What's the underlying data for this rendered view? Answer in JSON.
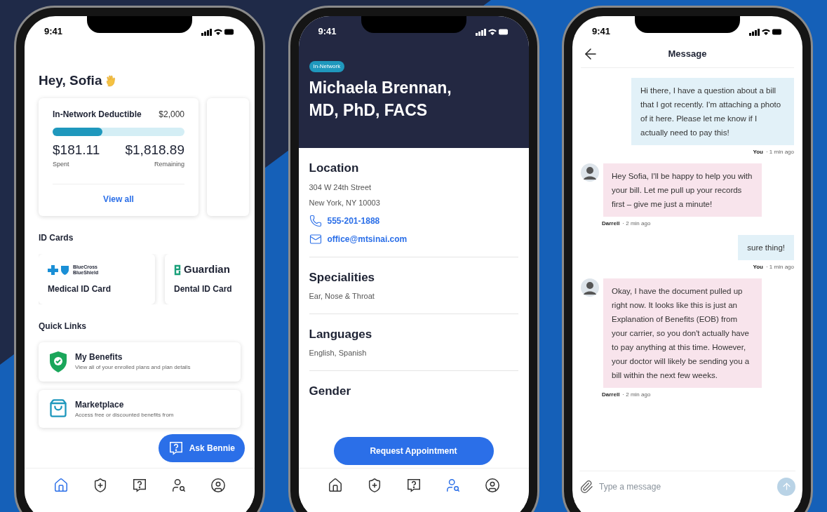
{
  "home_screen": {
    "status_time": "9:41",
    "greeting": "Hey, Sofia",
    "deductible": {
      "title": "In-Network Deductible",
      "amount": "$2,000",
      "level": 0.38,
      "spent": "$181.11",
      "spent_label": "Spent",
      "remaining": "$1,818.89",
      "remaining_label": "Remaining",
      "link": "View all"
    },
    "id_cards_heading": "ID Cards",
    "id_cards": [
      {
        "kind": "bcbs",
        "logo_text": "BlueCross BlueShield",
        "label": "Medical ID Card"
      },
      {
        "kind": "guardian",
        "logo_text": "Guardian",
        "label": "Dental ID Card"
      }
    ],
    "quick_links_heading": "Quick Links",
    "quick_links": [
      {
        "kind": "benefits",
        "title": "My Benefits",
        "description": "View all of your enrolled plans and plan details"
      },
      {
        "kind": "marketplace",
        "title": "Marketplace",
        "description": "Access free or discounted benefits from"
      }
    ],
    "fab": "Ask Bennie",
    "nav_tabs": [
      {
        "kind": "home",
        "selected": true
      },
      {
        "kind": "shield",
        "selected": false
      },
      {
        "kind": "help",
        "selected": false
      },
      {
        "kind": "find",
        "selected": false
      },
      {
        "kind": "profile",
        "selected": false
      }
    ]
  },
  "provider_screen": {
    "status_time": "9:41",
    "badge": "In-Network",
    "name": "Michaela Brennan, MD, PhD, FACS",
    "sections": [
      {
        "heading": "Location",
        "lines": [
          "304 W 24th Street",
          "New York, NY 10003"
        ],
        "contacts": [
          {
            "kind": "phone",
            "text": "555-201-1888"
          },
          {
            "kind": "email",
            "text": "office@mtsinai.com"
          }
        ]
      },
      {
        "heading": "Specialities",
        "lines": [
          "Ear, Nose & Throat"
        ]
      },
      {
        "heading": "Languages",
        "lines": [
          "English, Spanish"
        ]
      },
      {
        "heading": "Gender"
      }
    ],
    "cta": "Request Appointment",
    "nav_tabs": [
      {
        "kind": "home",
        "selected": false
      },
      {
        "kind": "shield",
        "selected": false
      },
      {
        "kind": "help",
        "selected": false
      },
      {
        "kind": "find",
        "selected": true
      },
      {
        "kind": "profile",
        "selected": false
      }
    ]
  },
  "message_screen": {
    "status_time": "9:41",
    "title": "Message",
    "messages": [
      {
        "kind": "you",
        "text": "Hi there, I have a question about a bill that I got recently. I'm attaching a photo of it here. Please let me know if I actually need to pay this!",
        "sender": "You",
        "time": "· 1 min ago"
      },
      {
        "kind": "agent",
        "text": "Hey Sofia, I'll be happy to help you with your bill. Let me pull up your records first – give me just a minute!",
        "sender": "Darrell",
        "time": "· 2 min ago"
      },
      {
        "kind": "you",
        "text": "sure thing!",
        "sender": "You",
        "time": "· 1 min ago"
      },
      {
        "kind": "agent",
        "text": "Okay, I have the document pulled up right now. It looks like this is just an Explanation of Benefits (EOB) from your carrier, so you don't actually have to pay anything at this time. However, your doctor will likely be sending you a bill within the next few weeks.",
        "sender": "Darrell",
        "time": "· 2 min ago"
      }
    ],
    "composer": {
      "placeholder": "Type a message"
    }
  }
}
